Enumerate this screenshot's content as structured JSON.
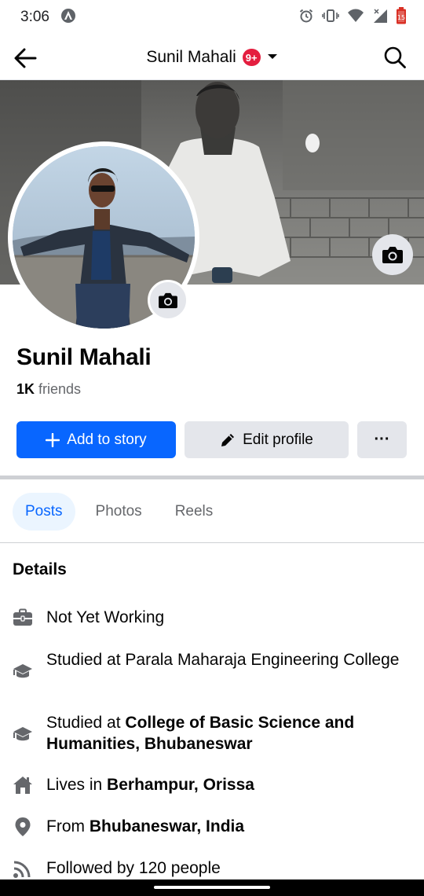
{
  "status_bar": {
    "time": "3:06",
    "icons": [
      "assistant-icon",
      "alarm-icon",
      "vibrate-icon",
      "wifi-icon",
      "cell-signal-icon",
      "battery-low-icon"
    ]
  },
  "header": {
    "title": "Sunil Mahali",
    "badge": "9+",
    "back_icon": "arrow-left-icon",
    "search_icon": "search-icon"
  },
  "profile": {
    "name": "Sunil Mahali",
    "friends_count": "1K",
    "friends_label": " friends"
  },
  "actions": {
    "add_story": "Add to story",
    "edit_profile": "Edit profile",
    "more": "···"
  },
  "tabs": [
    {
      "label": "Posts",
      "active": true
    },
    {
      "label": "Photos",
      "active": false
    },
    {
      "label": "Reels",
      "active": false
    }
  ],
  "details": {
    "heading": "Details",
    "items": [
      {
        "icon": "briefcase-icon",
        "prefix": "Not Yet Working",
        "bold": ""
      },
      {
        "icon": "graduation-cap-icon",
        "prefix": "Studied at Parala Maharaja Engineering College",
        "bold": ""
      },
      {
        "icon": "graduation-cap-icon",
        "prefix": "Studied at ",
        "bold": "College of Basic Science and Humanities, Bhubaneswar"
      },
      {
        "icon": "home-icon",
        "prefix": "Lives in ",
        "bold": "Berhampur, Orissa"
      },
      {
        "icon": "location-pin-icon",
        "prefix": "From ",
        "bold": "Bhubaneswar, India"
      },
      {
        "icon": "rss-followers-icon",
        "prefix": "Followed by 120 people",
        "bold": ""
      }
    ]
  },
  "colors": {
    "brand_blue": "#0866ff",
    "button_gray": "#e4e6eb",
    "badge_red": "#e41e3f",
    "secondary_text": "#65676b"
  }
}
